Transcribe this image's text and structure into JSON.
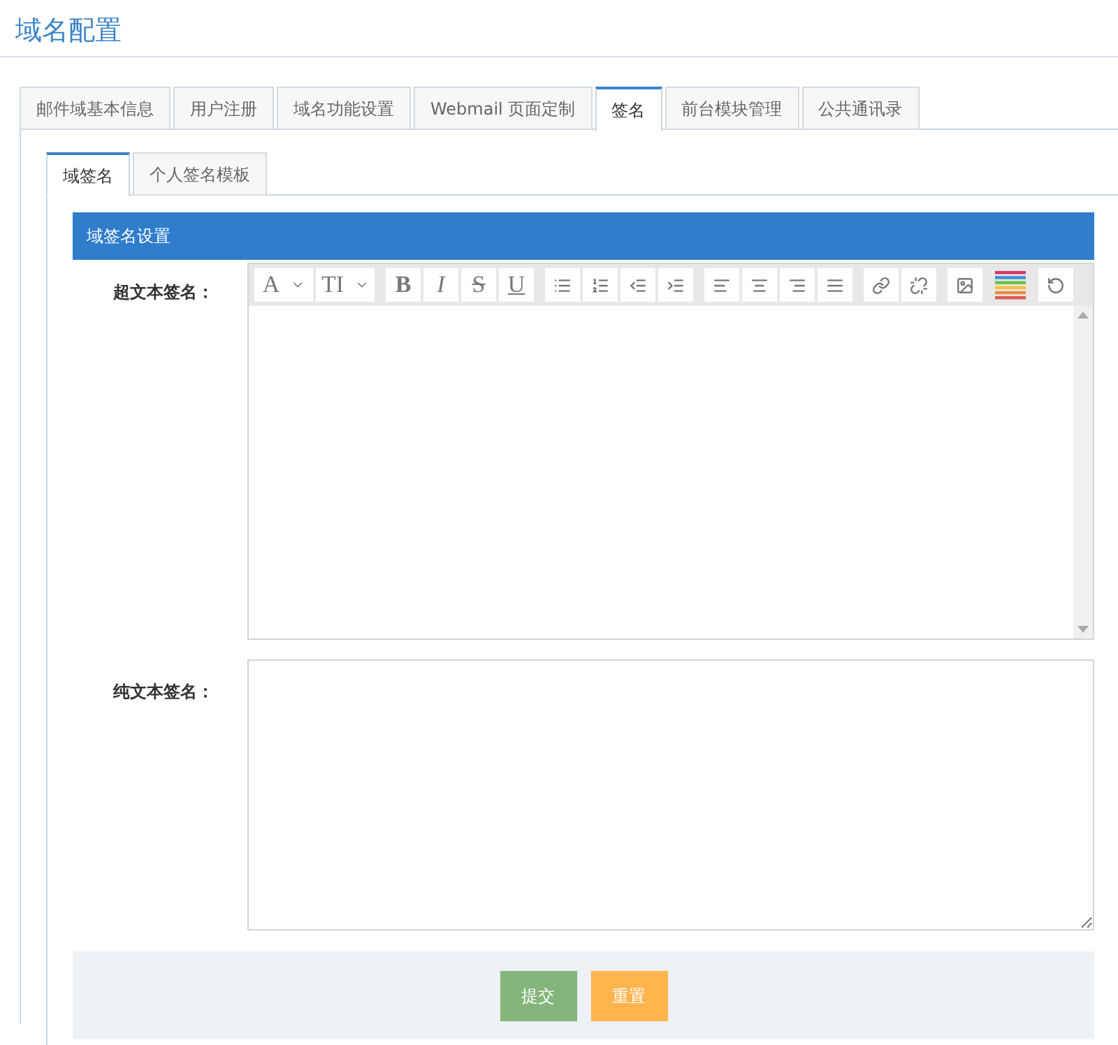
{
  "page_title": "域名配置",
  "tabs": [
    {
      "label": "邮件域基本信息",
      "selected": false
    },
    {
      "label": "用户注册",
      "selected": false
    },
    {
      "label": "域名功能设置",
      "selected": false
    },
    {
      "label": "Webmail 页面定制",
      "selected": false
    },
    {
      "label": "签名",
      "selected": true
    },
    {
      "label": "前台模块管理",
      "selected": false
    },
    {
      "label": "公共通讯录",
      "selected": false
    }
  ],
  "sub_tabs": [
    {
      "label": "域签名",
      "selected": true
    },
    {
      "label": "个人签名模板",
      "selected": false
    }
  ],
  "panel_title": "域签名设置",
  "rich_label": "超文本签名：",
  "toolbar": [
    [
      {
        "kind": "dropdown",
        "label": "A"
      },
      {
        "kind": "dropdown",
        "label": "TI"
      }
    ],
    [
      {
        "kind": "bold",
        "label": "B"
      },
      {
        "kind": "italic",
        "label": "I"
      },
      {
        "kind": "strike",
        "label": "S"
      },
      {
        "kind": "underline",
        "label": "U"
      }
    ],
    [
      {
        "kind": "bullets"
      },
      {
        "kind": "numbers"
      },
      {
        "kind": "outdent"
      },
      {
        "kind": "indent"
      }
    ],
    [
      {
        "kind": "align-left"
      },
      {
        "kind": "align-center"
      },
      {
        "kind": "align-right"
      },
      {
        "kind": "justify"
      }
    ],
    [
      {
        "kind": "link"
      },
      {
        "kind": "unlink"
      }
    ],
    [
      {
        "kind": "image"
      }
    ],
    [
      {
        "kind": "colors"
      }
    ],
    [
      {
        "kind": "undo"
      }
    ]
  ],
  "plain_label": "纯文本签名：",
  "buttons": [
    {
      "label": "提交",
      "kind": "primary"
    },
    {
      "label": "重置",
      "kind": "secondary"
    }
  ]
}
